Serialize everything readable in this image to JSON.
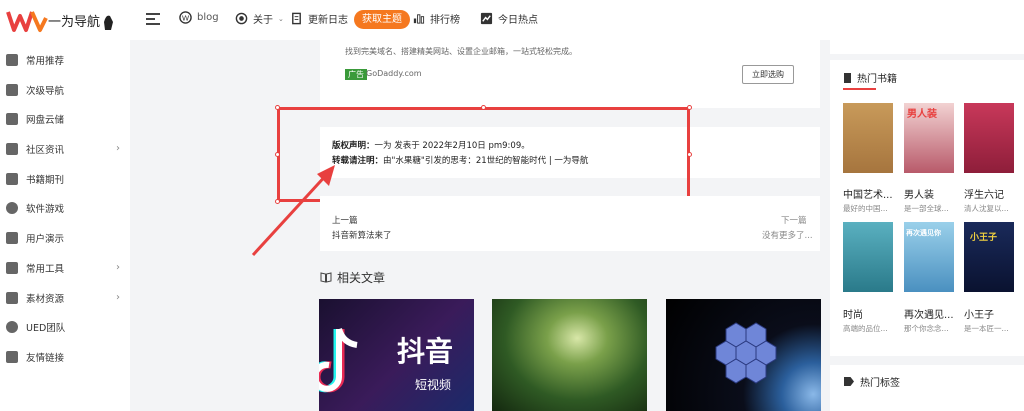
{
  "header": {
    "logo_text": "一为导航",
    "nav": [
      {
        "label": "blog",
        "icon": "wordpress-icon"
      },
      {
        "label": "关于",
        "icon": "circle-dot-icon"
      },
      {
        "label": "更新日志",
        "icon": "document-icon"
      },
      {
        "label": "获取主题",
        "icon": ""
      },
      {
        "label": "排行榜",
        "icon": "bar-chart-icon"
      },
      {
        "label": "今日热点",
        "icon": "trend-chart-icon"
      }
    ],
    "accent": "#f5781f"
  },
  "sidebar": {
    "items": [
      {
        "label": "常用推荐",
        "icon": "grid-icon",
        "chevron": false
      },
      {
        "label": "次级导航",
        "icon": "layers-icon",
        "chevron": false
      },
      {
        "label": "网盘云储",
        "icon": "drive-icon",
        "chevron": false
      },
      {
        "label": "社区资讯",
        "icon": "chat-icon",
        "chevron": true
      },
      {
        "label": "书籍期刊",
        "icon": "book-icon",
        "chevron": false
      },
      {
        "label": "软件游戏",
        "icon": "gear-icon",
        "chevron": false
      },
      {
        "label": "用户演示",
        "icon": "user-icon",
        "chevron": false
      },
      {
        "label": "常用工具",
        "icon": "toolbox-icon",
        "chevron": true
      },
      {
        "label": "素材资源",
        "icon": "image-icon",
        "chevron": true
      },
      {
        "label": "UED团队",
        "icon": "team-icon",
        "chevron": false
      },
      {
        "label": "友情链接",
        "icon": "link-icon",
        "chevron": false
      }
    ]
  },
  "ad": {
    "description": "找到完美域名、搭建精美网站、设置企业邮箱，一站式轻松完成。",
    "tag": "广告",
    "domain": "GoDaddy.com",
    "button": "立即选购"
  },
  "copyright": {
    "line1_label": "版权声明：",
    "line1_text": "一为 发表于 2022年2月10日 pm9:09。",
    "line2_label": "转载请注明：",
    "line2_text": "由\"水果糖\"引发的思考：21世纪的智能时代 | 一为导航"
  },
  "pager": {
    "prev_label": "上一篇",
    "prev_title": "抖音新算法来了",
    "next_label": "下一篇",
    "next_title": "没有更多了..."
  },
  "related": {
    "title": "相关文章",
    "thumb_texts": [
      "抖音",
      "短视频"
    ]
  },
  "hot_books": {
    "title": "热门书籍",
    "books": [
      {
        "title": "中国艺术...",
        "desc": "最好的中国..."
      },
      {
        "title": "男人装",
        "desc": "是一部全球..."
      },
      {
        "title": "浮生六记",
        "desc": "清人沈复以..."
      },
      {
        "title": "时尚",
        "desc": "高端的品位..."
      },
      {
        "title": "再次遇见...",
        "desc": "那个你念念..."
      },
      {
        "title": "小王子",
        "desc": "是一本匠一..."
      }
    ],
    "cover_texts": [
      "男人装",
      "再次遇见你",
      "小王子"
    ]
  },
  "hot_tags": {
    "title": "热门标签"
  }
}
